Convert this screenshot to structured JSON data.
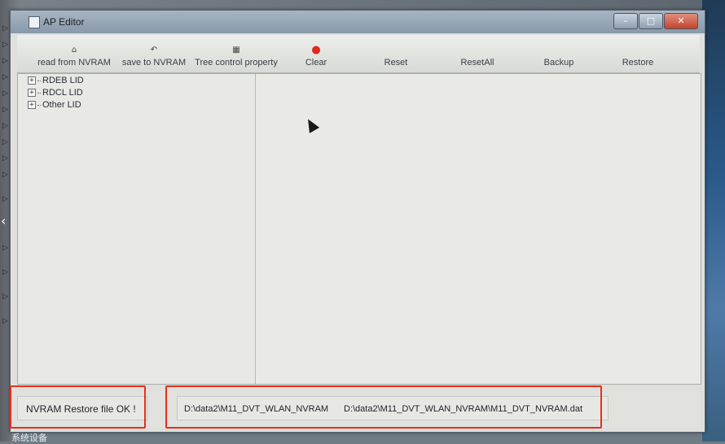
{
  "window": {
    "title": "AP Editor",
    "controls": [
      "–",
      "□",
      "✕"
    ]
  },
  "toolbar": {
    "buttons": [
      {
        "label": "read from NVRAM",
        "icon": "read-icon"
      },
      {
        "label": "save to NVRAM",
        "icon": "save-arrow-icon"
      },
      {
        "label": "Tree control property",
        "icon": "tree-property-icon"
      },
      {
        "label": "Clear",
        "icon": "clear-red-icon"
      },
      {
        "label": "Reset",
        "icon": ""
      },
      {
        "label": "ResetAll",
        "icon": ""
      },
      {
        "label": "Backup",
        "icon": ""
      },
      {
        "label": "Restore",
        "icon": ""
      }
    ]
  },
  "tree": {
    "items": [
      {
        "label": "RDEB LID",
        "expander": "+"
      },
      {
        "label": "RDCL LID",
        "expander": "+"
      },
      {
        "label": "Other LID",
        "expander": "+"
      }
    ]
  },
  "status": {
    "message": "NVRAM Restore file OK !",
    "path_short": "D:\\data2\\M11_DVT_WLAN_NVRAM",
    "path_full": "D:\\data2\\M11_DVT_WLAN_NVRAM\\M11_DVT_NVRAM.dat"
  },
  "taskbar": {
    "label": "系统设备"
  },
  "colors": {
    "highlight": "#e8301e",
    "clear_icon": "#e0281e"
  }
}
